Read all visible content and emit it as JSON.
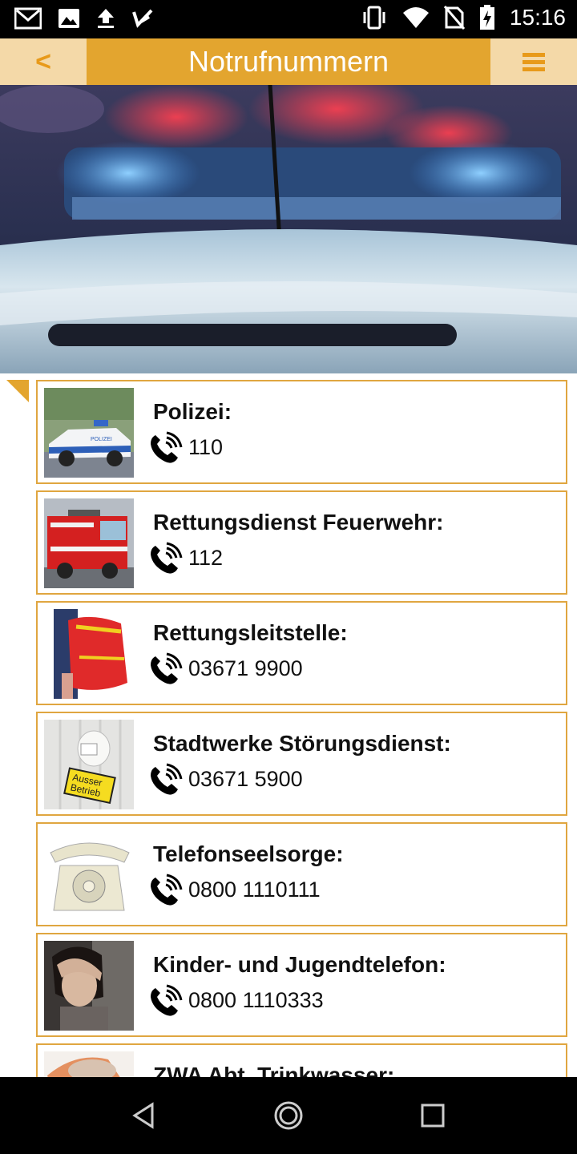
{
  "status_bar": {
    "time": "15:16",
    "left_icons": [
      "gmail-icon",
      "image-icon",
      "upload-icon",
      "check-icon"
    ],
    "right_icons": [
      "vibrate-icon",
      "wifi-icon",
      "no-sim-icon",
      "battery-charging-icon"
    ]
  },
  "header": {
    "back_label": "<",
    "title": "Notrufnummern",
    "menu_icon": "hamburger-menu-icon",
    "accent": "#e3a52f",
    "light": "#f4d9a8"
  },
  "hero": {
    "image": "police-car-blue-light-photo"
  },
  "entries": [
    {
      "title": "Polizei:",
      "number": "110",
      "image": "police-car-photo"
    },
    {
      "title": "Rettungsdienst Feuerwehr:",
      "number": "112",
      "image": "fire-truck-photo"
    },
    {
      "title": "Rettungsleitstelle:",
      "number": "03671 9900",
      "image": "rescue-backpack-photo"
    },
    {
      "title": "Stadtwerke Störungsdienst:",
      "number": "03671 5900",
      "image": "radiator-ausser-betrieb-photo",
      "image_text": "Ausser Betrieb"
    },
    {
      "title": "Telefonseelsorge:",
      "number": "0800 1110111",
      "image": "rotary-telephone-photo"
    },
    {
      "title": "Kinder- und Jugendtelefon:",
      "number": "0800 1110333",
      "image": "distressed-girl-photo"
    },
    {
      "title": "ZWA Abt. Trinkwasser:",
      "number": "",
      "image": "water-photo"
    }
  ],
  "nav": {
    "back": "nav-back-icon",
    "home": "nav-home-icon",
    "recents": "nav-recents-icon"
  }
}
